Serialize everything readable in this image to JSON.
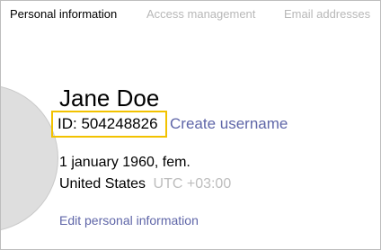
{
  "tabs": [
    {
      "label": "Personal information",
      "active": true
    },
    {
      "label": "Access management",
      "active": false
    },
    {
      "label": "Email addresses",
      "active": false
    }
  ],
  "profile": {
    "name": "Jane Doe",
    "id_text": "ID: 504248826",
    "create_username": "Create username",
    "dob_gender": "1 january 1960, fem.",
    "country": "United States",
    "timezone": "UTC +03:00",
    "edit_link": "Edit personal information"
  },
  "colors": {
    "highlight_border": "#f2c200",
    "link": "#5f66a8",
    "muted": "#b8b8b8",
    "avatar_fill": "#dedede"
  }
}
